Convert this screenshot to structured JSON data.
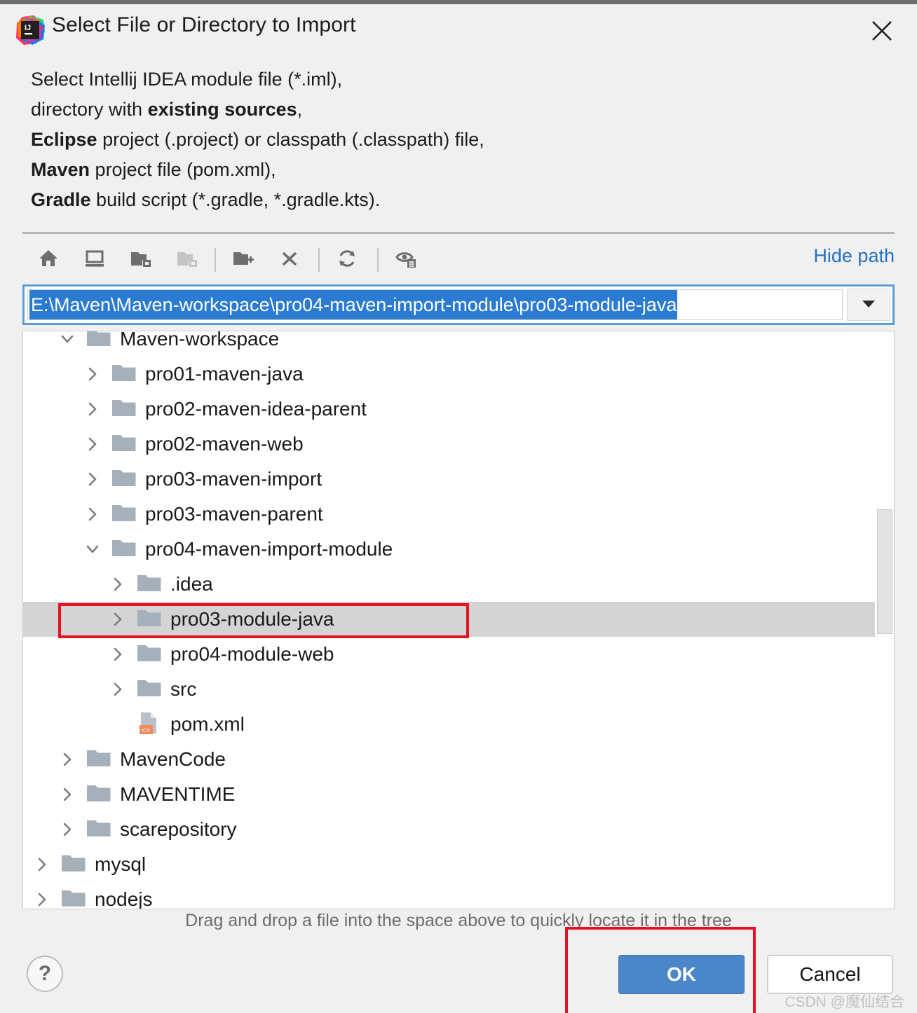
{
  "window": {
    "title": "Select File or Directory to Import",
    "logo_icon": "intellij-idea-logo",
    "close_icon": "close-icon"
  },
  "description": {
    "line1_prefix": "Select Intellij IDEA module file (*.iml),",
    "line2_prefix": "directory with ",
    "line2_bold": "existing sources",
    "line2_suffix": ",",
    "line3_bold": "Eclipse",
    "line3_suffix": " project (.project) or classpath (.classpath) file,",
    "line4_bold": "Maven",
    "line4_suffix": " project file (pom.xml),",
    "line5_bold": "Gradle",
    "line5_suffix": " build script (*.gradle, *.gradle.kts)."
  },
  "toolbar": {
    "buttons": [
      {
        "name": "home-icon",
        "tooltip": "Home",
        "enabled": true
      },
      {
        "name": "desktop-icon",
        "tooltip": "Desktop",
        "enabled": true
      },
      {
        "name": "project-folder-icon",
        "tooltip": "Project Directory",
        "enabled": true
      },
      {
        "name": "module-folder-icon",
        "tooltip": "Module Directory",
        "enabled": false
      },
      {
        "name": "new-folder-icon",
        "tooltip": "New Folder",
        "enabled": true
      },
      {
        "name": "delete-icon",
        "tooltip": "Delete",
        "enabled": true
      },
      {
        "name": "refresh-icon",
        "tooltip": "Refresh",
        "enabled": true
      },
      {
        "name": "show-hidden-files-icon",
        "tooltip": "Show Hidden Files and Directories",
        "enabled": true
      }
    ],
    "hide_path_label": "Hide path"
  },
  "path_combo": {
    "value": "E:\\Maven\\Maven-workspace\\pro04-maven-import-module\\pro03-module-java",
    "selected": true,
    "dropdown_icon": "chevron-down-icon",
    "selection_color": "#2a7bd1",
    "focus_border_color": "#5a9fd4"
  },
  "tree": {
    "rows": [
      {
        "label": "Maven-workspace",
        "indent": 3,
        "twisty": "down",
        "icon": "folder-icon",
        "selected": false
      },
      {
        "label": "pro01-maven-java",
        "indent": 4,
        "twisty": "right",
        "icon": "folder-icon",
        "selected": false
      },
      {
        "label": "pro02-maven-idea-parent",
        "indent": 4,
        "twisty": "right",
        "icon": "folder-icon",
        "selected": false
      },
      {
        "label": "pro02-maven-web",
        "indent": 4,
        "twisty": "right",
        "icon": "folder-icon",
        "selected": false
      },
      {
        "label": "pro03-maven-import",
        "indent": 4,
        "twisty": "right",
        "icon": "folder-icon",
        "selected": false
      },
      {
        "label": "pro03-maven-parent",
        "indent": 4,
        "twisty": "right",
        "icon": "folder-icon",
        "selected": false
      },
      {
        "label": "pro04-maven-import-module",
        "indent": 4,
        "twisty": "down",
        "icon": "folder-icon",
        "selected": false
      },
      {
        "label": ".idea",
        "indent": 5,
        "twisty": "right",
        "icon": "folder-icon",
        "selected": false
      },
      {
        "label": "pro03-module-java",
        "indent": 5,
        "twisty": "right",
        "icon": "folder-icon",
        "selected": true
      },
      {
        "label": "pro04-module-web",
        "indent": 5,
        "twisty": "right",
        "icon": "folder-icon",
        "selected": false
      },
      {
        "label": "src",
        "indent": 5,
        "twisty": "right",
        "icon": "folder-icon",
        "selected": false
      },
      {
        "label": "pom.xml",
        "indent": 5,
        "twisty": "none",
        "icon": "xml-file-icon",
        "selected": false
      },
      {
        "label": "MavenCode",
        "indent": 3,
        "twisty": "right",
        "icon": "folder-icon",
        "selected": false
      },
      {
        "label": "MAVENTIME",
        "indent": 3,
        "twisty": "right",
        "icon": "folder-icon",
        "selected": false
      },
      {
        "label": "scarepository",
        "indent": 3,
        "twisty": "right",
        "icon": "folder-icon",
        "selected": false
      },
      {
        "label": "mysql",
        "indent": 2,
        "twisty": "right",
        "icon": "folder-icon",
        "selected": false
      },
      {
        "label": "nodejs",
        "indent": 2,
        "twisty": "right",
        "icon": "folder-icon",
        "selected": false
      }
    ],
    "selection_color": "#d4d4d4",
    "annotation_color": "#e81123"
  },
  "hint": {
    "text": "Drag and drop a file into the space above to quickly locate it in the tree"
  },
  "footer": {
    "help_label": "?",
    "ok_label": "OK",
    "cancel_label": "Cancel",
    "ok_color": "#4a86c8"
  },
  "watermark": {
    "text": "CSDN @魔仙结合"
  }
}
